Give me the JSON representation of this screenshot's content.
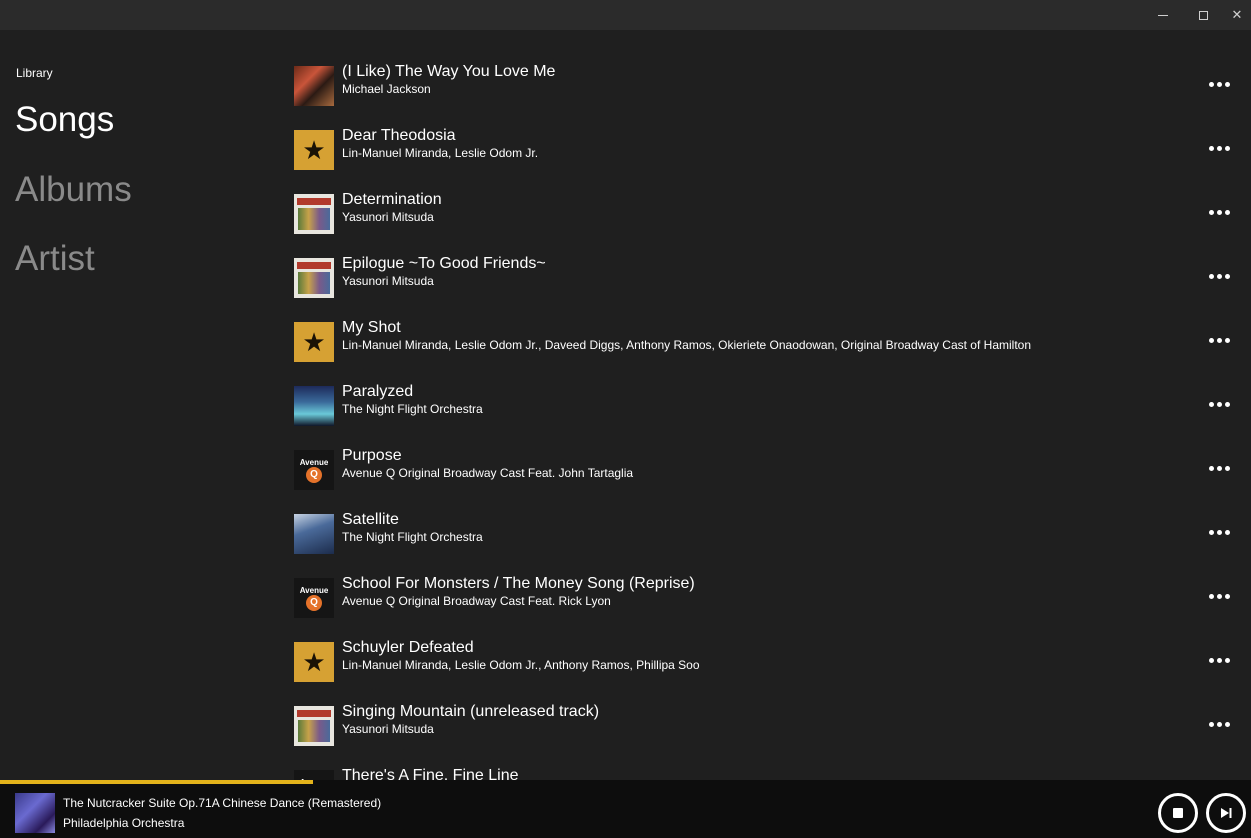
{
  "window": {
    "minimize_icon": "minimize-icon",
    "maximize_icon": "maximize-icon",
    "close_icon": "close-icon",
    "close_glyph": "✕"
  },
  "sidebar": {
    "heading": "Library",
    "items": [
      {
        "label": "Songs",
        "active": true
      },
      {
        "label": "Albums",
        "active": false
      },
      {
        "label": "Artist",
        "active": false
      }
    ]
  },
  "songs": [
    {
      "title": "(I Like) The Way You Love Me",
      "artist": "Michael Jackson",
      "art": "art-mj"
    },
    {
      "title": "Dear Theodosia",
      "artist": "Lin-Manuel Miranda, Leslie Odom Jr.",
      "art": "art-ham"
    },
    {
      "title": "Determination",
      "artist": "Yasunori Mitsuda",
      "art": "art-ct"
    },
    {
      "title": "Epilogue ~To Good Friends~",
      "artist": "Yasunori Mitsuda",
      "art": "art-ct"
    },
    {
      "title": "My Shot",
      "artist": "Lin-Manuel Miranda, Leslie Odom Jr., Daveed Diggs, Anthony Ramos, Okieriete Onaodowan, Original Broadway Cast of Hamilton",
      "art": "art-ham"
    },
    {
      "title": "Paralyzed",
      "artist": "The Night Flight Orchestra",
      "art": "art-par"
    },
    {
      "title": "Purpose",
      "artist": "Avenue Q Original Broadway Cast Feat. John Tartaglia",
      "art": "art-aq"
    },
    {
      "title": "Satellite",
      "artist": "The Night Flight Orchestra",
      "art": "art-sat"
    },
    {
      "title": "School For Monsters / The Money Song (Reprise)",
      "artist": "Avenue Q Original Broadway Cast Feat. Rick Lyon",
      "art": "art-aq"
    },
    {
      "title": "Schuyler Defeated",
      "artist": "Lin-Manuel Miranda, Leslie Odom Jr., Anthony Ramos, Phillipa Soo",
      "art": "art-ham"
    },
    {
      "title": "Singing Mountain (unreleased track)",
      "artist": "Yasunori Mitsuda",
      "art": "art-ct"
    },
    {
      "title": "There's A Fine, Fine Line",
      "artist": "",
      "art": "art-aq"
    }
  ],
  "album_art_text": {
    "avenue": "Avenue",
    "q": "Q"
  },
  "player": {
    "title": "The Nutcracker Suite Op.71A Chinese Dance (Remastered)",
    "artist": "Philadelphia Orchestra",
    "progress": 0.25,
    "accent": "#e3b31b",
    "controls": [
      {
        "icon": "stop-icon"
      },
      {
        "icon": "skip-next-icon"
      }
    ]
  }
}
